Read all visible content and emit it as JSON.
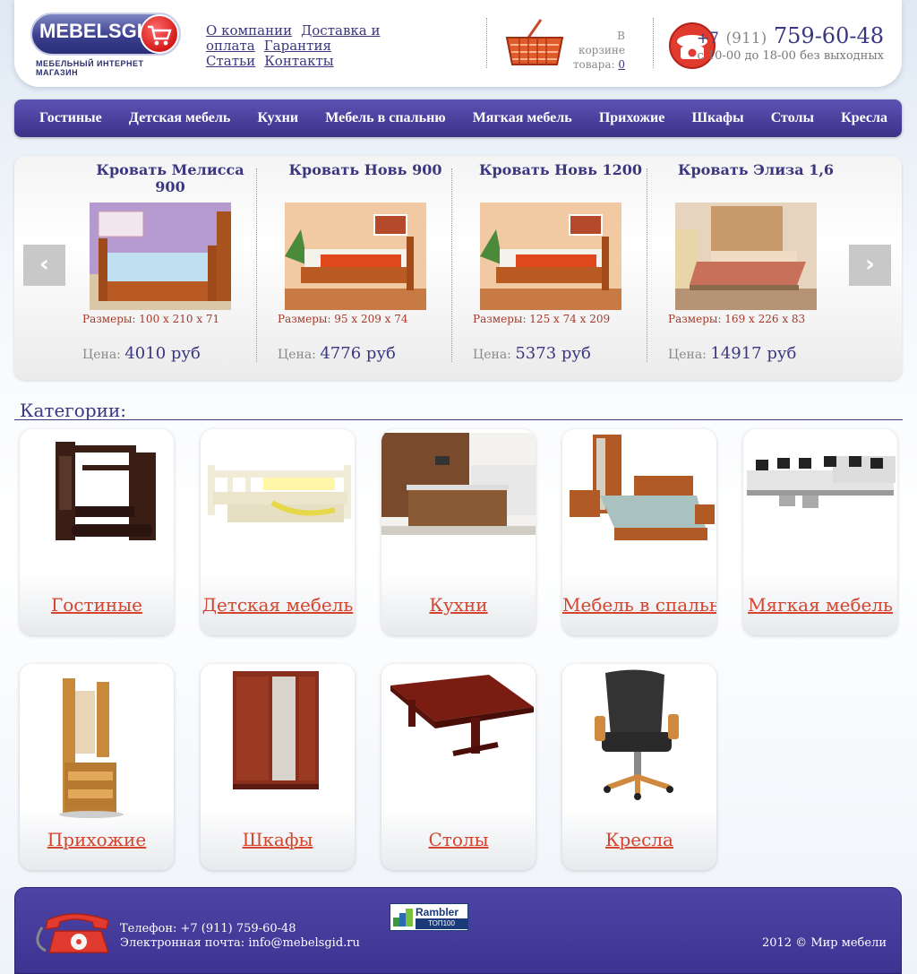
{
  "header": {
    "logo_text": "MEBELSGID",
    "logo_subtitle": "МЕБЕЛЬНЫЙ ИНТЕРНЕТ МАГАЗИН",
    "top_links": [
      "О компании",
      "Доставка и оплата",
      "Гарантия",
      "Статьи",
      "Контакты"
    ],
    "cart_label_1": "В корзине",
    "cart_label_2": "товара:",
    "cart_count": "0",
    "phone_country": "+7",
    "phone_area": "(911)",
    "phone_number": "759-60-48",
    "phone_hours": "с 10-00 до 18-00 без выходных"
  },
  "main_nav": [
    "Гостиные",
    "Детская мебель",
    "Кухни",
    "Мебель в спальню",
    "Мягкая мебель",
    "Прихожие",
    "Шкафы",
    "Столы",
    "Кресла"
  ],
  "carousel": {
    "prev_icon": "chevron-left-icon",
    "next_icon": "chevron-right-icon",
    "items": [
      {
        "title": "Кровать Мелисса 900",
        "sizes": "Размеры: 100 x 210 x 71",
        "price_label": "Цена:",
        "price": "4010 руб"
      },
      {
        "title": "Кровать Новь 900",
        "sizes": "Размеры: 95 x 209 x 74",
        "price_label": "Цена:",
        "price": "4776 руб"
      },
      {
        "title": "Кровать Новь 1200",
        "sizes": "Размеры: 125 x 74 x 209",
        "price_label": "Цена:",
        "price": "5373 руб"
      },
      {
        "title": "Кровать Элиза 1,6",
        "sizes": "Размеры: 169 x 226 x 83",
        "price_label": "Цена:",
        "price": "14917 руб"
      }
    ]
  },
  "categories": {
    "title": "Категории:",
    "items": [
      "Гостиные",
      "Детская мебель",
      "Кухни",
      "Мебель в спальню",
      "Мягкая мебель",
      "Прихожие",
      "Шкафы",
      "Столы",
      "Кресла"
    ]
  },
  "footer": {
    "phone_line": "Телефон: +7 (911) 759-60-48",
    "email_line": "Электронная почта: info@mebelsgid.ru",
    "counter_name": "Rambler",
    "counter_sub": "ТОП100",
    "copyright": "2012 © Мир мебели"
  },
  "colors": {
    "brand_purple": "#3b3680",
    "nav_purple": "#4b3f9c",
    "accent_red": "#d4442e",
    "size_text": "#a33a2a"
  }
}
